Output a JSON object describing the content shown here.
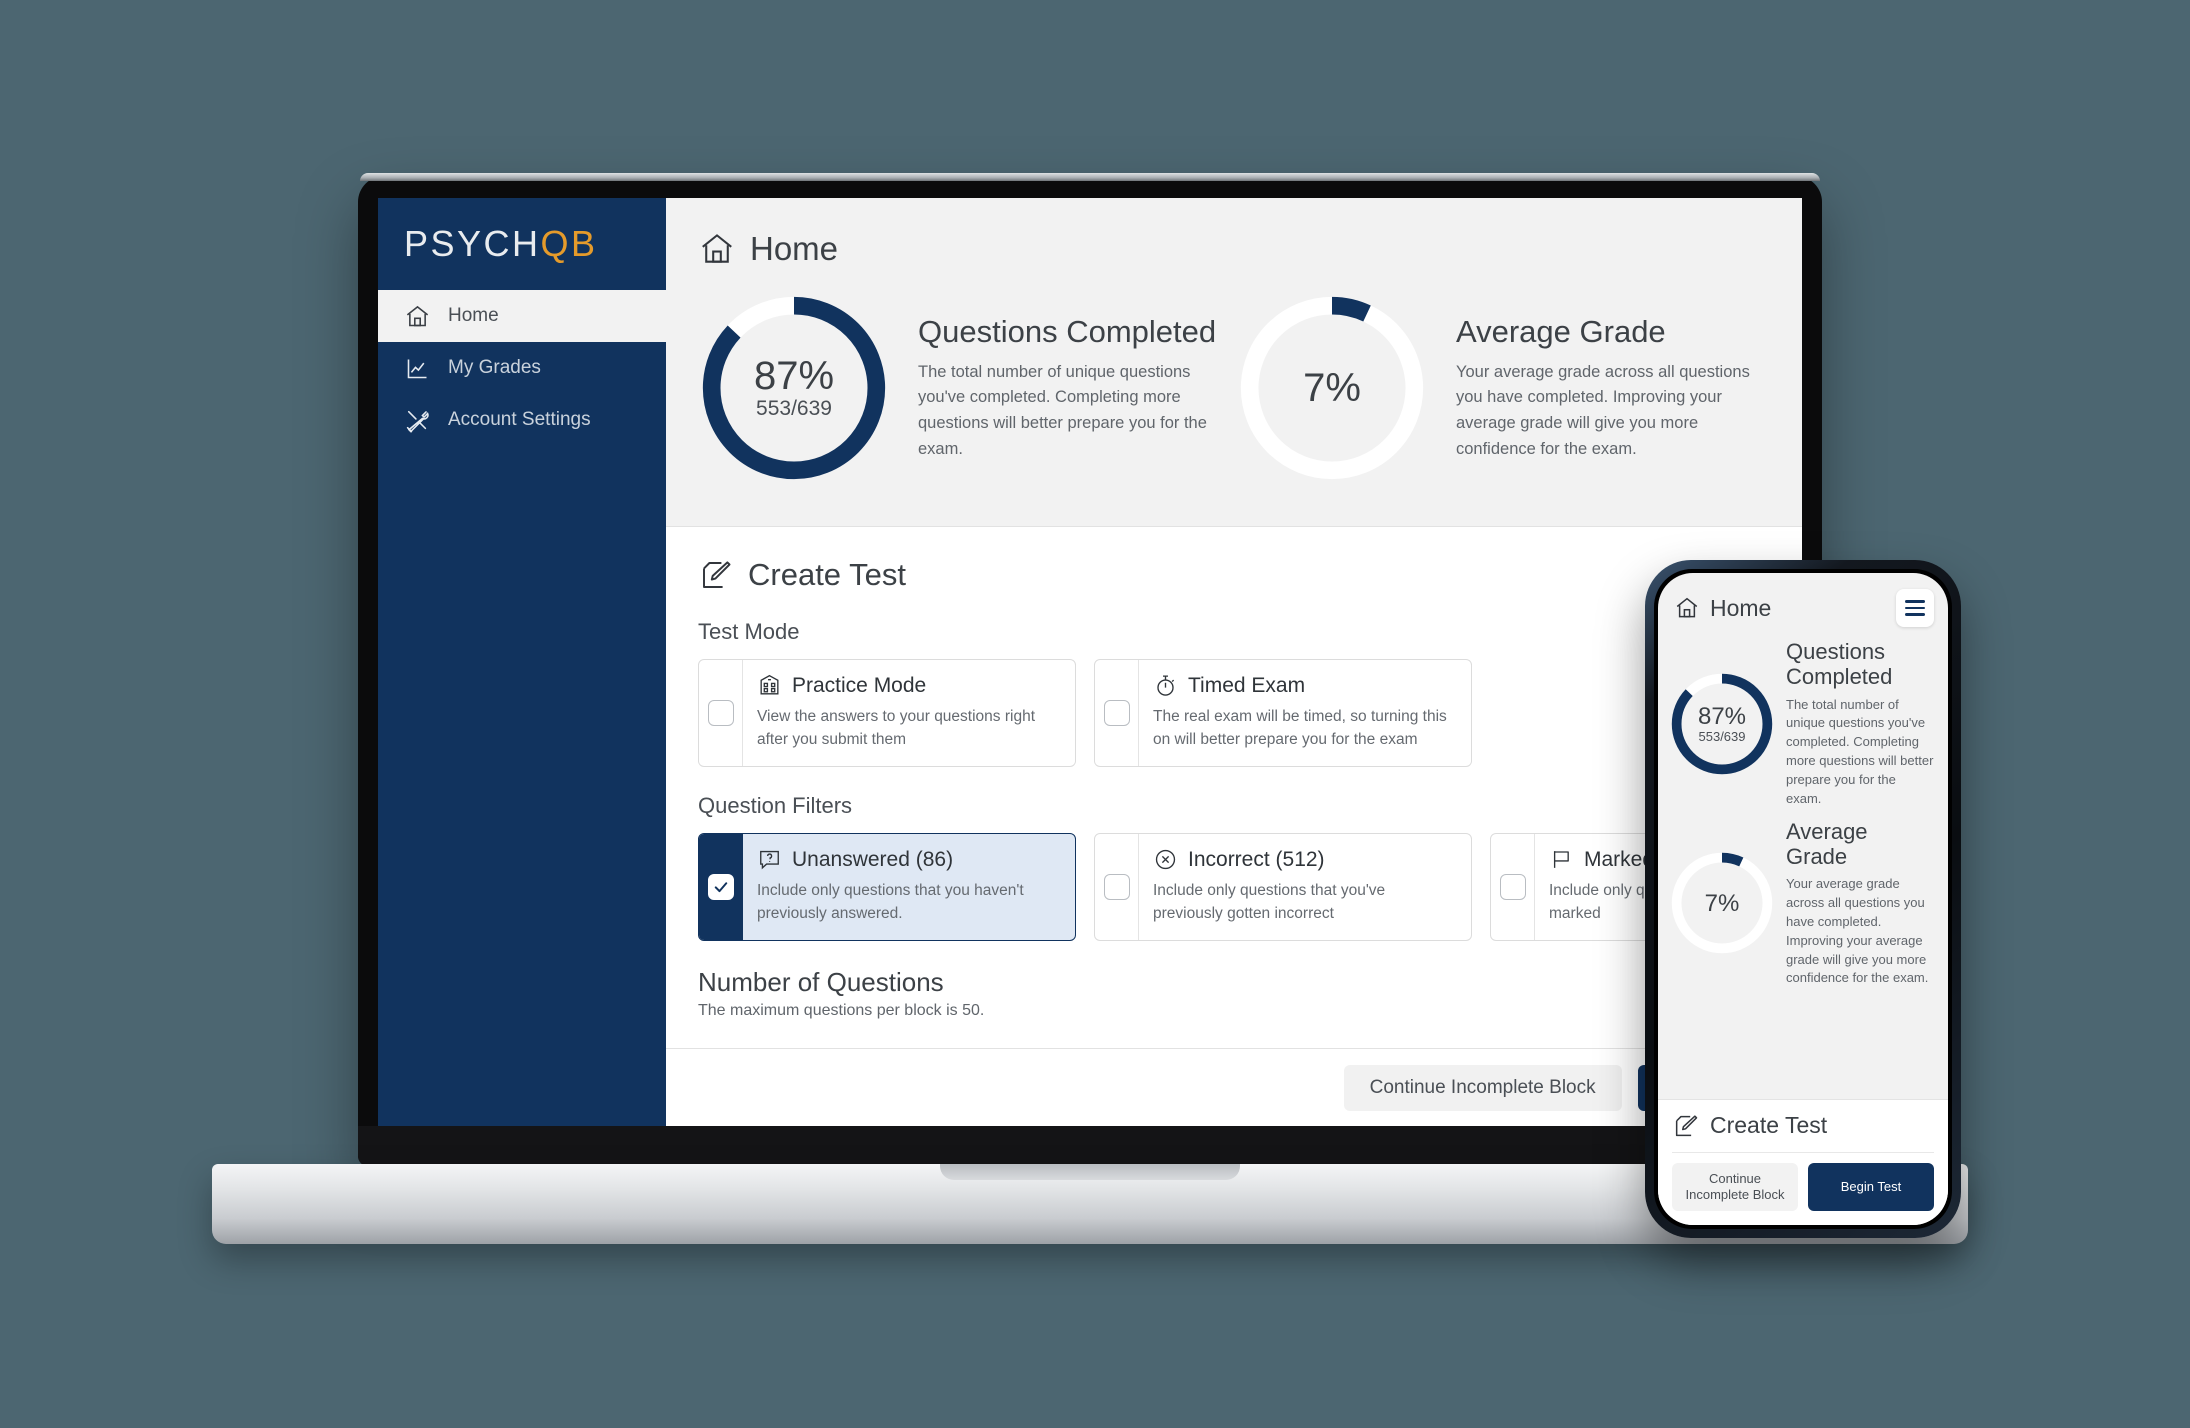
{
  "theme": {
    "page_background": "#4c6671",
    "navy": "#11335e",
    "accent_orange": "#e59b2b",
    "track_white": "#ffffff",
    "panel_gray": "#f2f2f2"
  },
  "brand": {
    "name_primary": "PSYCH",
    "name_accent": "QB"
  },
  "sidebar": {
    "items": [
      {
        "label": "Home",
        "icon": "home-icon",
        "active": true
      },
      {
        "label": "My Grades",
        "icon": "chart-line-icon",
        "active": false
      },
      {
        "label": "Account Settings",
        "icon": "tools-icon",
        "active": false
      }
    ]
  },
  "page": {
    "title": "Home",
    "icon": "home-icon"
  },
  "stats": [
    {
      "percent_label": "87%",
      "sub_label": "553/639",
      "title": "Questions Completed",
      "description": "The total number of unique questions you've completed. Completing more questions will better prepare you for the exam.",
      "value": 87
    },
    {
      "percent_label": "7%",
      "sub_label": "",
      "title": "Average Grade",
      "description": "Your average grade across all questions you have completed. Improving your average grade will give you more confidence for the exam.",
      "value": 7
    }
  ],
  "create_test": {
    "title": "Create Test",
    "icon": "pencil-square-icon",
    "test_mode_label": "Test Mode",
    "test_modes": [
      {
        "label": "Practice Mode",
        "icon": "school-icon",
        "description": "View the answers to your questions right after you submit them",
        "checked": false
      },
      {
        "label": "Timed Exam",
        "icon": "stopwatch-icon",
        "description": "The real exam will be timed, so turning this on will better prepare you for the exam",
        "checked": false
      }
    ],
    "question_filters_label": "Question Filters",
    "question_filters": [
      {
        "label": "Unanswered (86)",
        "icon": "question-bubble-icon",
        "description": "Include only questions that you haven't previously answered.",
        "checked": true
      },
      {
        "label": "Incorrect (512)",
        "icon": "x-circle-icon",
        "description": "Include only questions that you've previously gotten incorrect",
        "checked": false
      },
      {
        "label": "Marked (0)",
        "icon": "flag-icon",
        "description": "Include only questions that you previously marked",
        "checked": false
      }
    ],
    "number_of_questions_label": "Number of Questions",
    "number_of_questions_desc": "The maximum questions per block is 50."
  },
  "actions": {
    "continue_label": "Continue Incomplete Block",
    "begin_label": "Begin Test"
  },
  "phone": {
    "title": "Home",
    "menu_icon": "hamburger-menu-icon",
    "stats": [
      {
        "percent_label": "87%",
        "sub_label": "553/639",
        "title": "Questions Completed",
        "description": "The total number of unique questions you've completed. Completing more questions will better prepare you for the exam.",
        "value": 87
      },
      {
        "percent_label": "7%",
        "sub_label": "",
        "title": "Average Grade",
        "description": "Your average grade across all questions you have completed. Improving your average grade will give you more confidence for the exam.",
        "value": 7
      }
    ],
    "create_test_title": "Create Test",
    "continue_label": "Continue Incomplete Block",
    "begin_label": "Begin Test"
  }
}
